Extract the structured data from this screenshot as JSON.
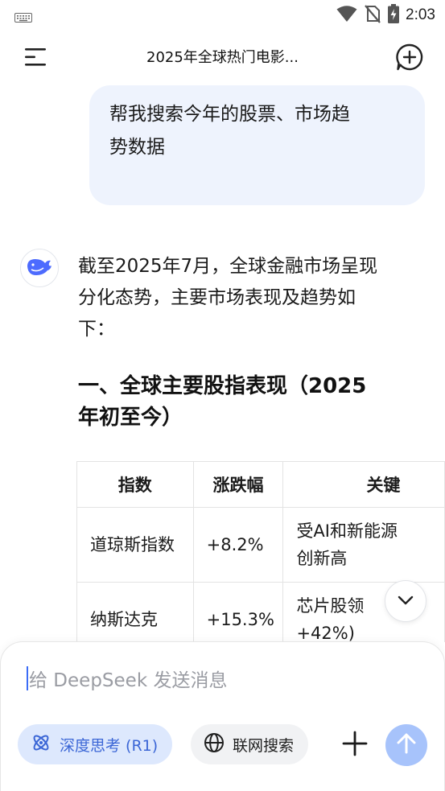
{
  "status_bar": {
    "time": "2:03",
    "icons": [
      "keyboard-icon",
      "wifi-icon",
      "no-sim-icon",
      "battery-charging-icon"
    ]
  },
  "header": {
    "title": "2025年全球热门电影...",
    "icons": [
      "menu-icon",
      "new-chat-icon"
    ]
  },
  "user_message": {
    "line1": "帮我搜索今年的股票、市场趋",
    "line2": "势数据"
  },
  "assistant": {
    "avatar_icon": "deepseek-whale-icon",
    "intro_line1": "截至2025年7月，全球金融市场呈现",
    "intro_line2": "分化态势，主要市场表现及趋势如",
    "intro_line3": "下：",
    "heading_line1": "一、全球主要股指表现（2025",
    "heading_line2": "年初至今）",
    "table": {
      "headers": [
        "指数",
        "涨跌幅",
        "关键"
      ],
      "rows": [
        {
          "index": "道琼斯指数",
          "change": "+8.2%",
          "note_line1": "受AI和新能源",
          "note_line2": "创新高"
        },
        {
          "index": "纳斯达克",
          "change": "+15.3%",
          "note_line1": "芯片股领",
          "note_line2": "+42%)"
        }
      ]
    }
  },
  "composer": {
    "placeholder": "给 DeepSeek 发送消息",
    "deep_think_label": "深度思考 (R1)",
    "web_search_label": "联网搜索"
  },
  "colors": {
    "accent": "#3b66d6",
    "user_bubble": "#eef3fd",
    "chip_active": "#dde8fd",
    "send_disabled": "#a7c3fb"
  }
}
